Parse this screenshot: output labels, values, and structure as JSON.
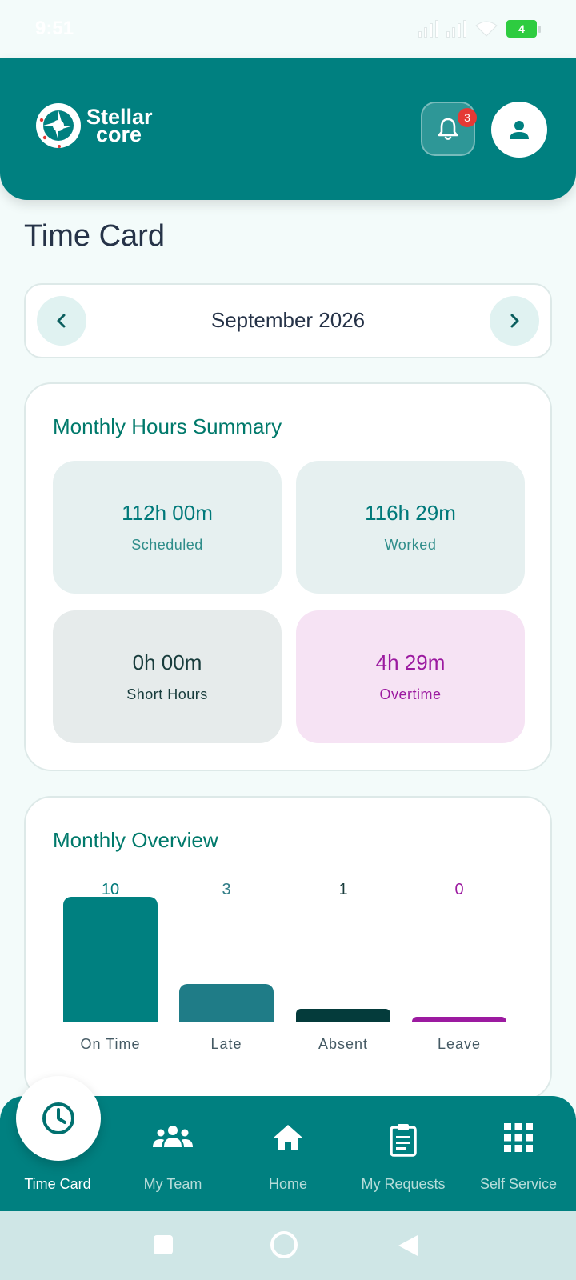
{
  "status_bar": {
    "time": "9:51",
    "battery": "4"
  },
  "header": {
    "logo_line1": "Stellar",
    "logo_line2": "core",
    "notification_count": "3"
  },
  "page": {
    "title": "Time Card"
  },
  "month_selector": {
    "label": "September 2026"
  },
  "summary": {
    "title": "Monthly Hours Summary",
    "tiles": [
      {
        "value": "112h 00m",
        "label": "Scheduled"
      },
      {
        "value": "116h 29m",
        "label": "Worked"
      },
      {
        "value": "0h 00m",
        "label": "Short Hours"
      },
      {
        "value": "4h 29m",
        "label": "Overtime"
      }
    ]
  },
  "overview": {
    "title": "Monthly Overview"
  },
  "chart_data": {
    "type": "bar",
    "categories": [
      "On Time",
      "Late",
      "Absent",
      "Leave"
    ],
    "values": [
      10,
      3,
      1,
      0
    ],
    "value_labels": [
      "10",
      "3",
      "1",
      "0"
    ],
    "colors": [
      "#008080",
      "#1f7c87",
      "#043b3b",
      "#9c1aa0"
    ],
    "value_colors": [
      "#00797a",
      "#2f7c86",
      "#183c3c",
      "#9c1aa0"
    ],
    "ylim": [
      0,
      10
    ]
  },
  "bottom_nav": {
    "items": [
      {
        "label": "Time Card",
        "icon": "clock-icon"
      },
      {
        "label": "My Team",
        "icon": "group-icon"
      },
      {
        "label": "Home",
        "icon": "home-icon"
      },
      {
        "label": "My Requests",
        "icon": "clipboard-icon"
      },
      {
        "label": "Self Service",
        "icon": "grid-icon"
      }
    ]
  },
  "colors": {
    "primary": "#008080",
    "background": "#f3fbfa",
    "overtime": "#9c1aa0",
    "badge": "#e53935"
  }
}
